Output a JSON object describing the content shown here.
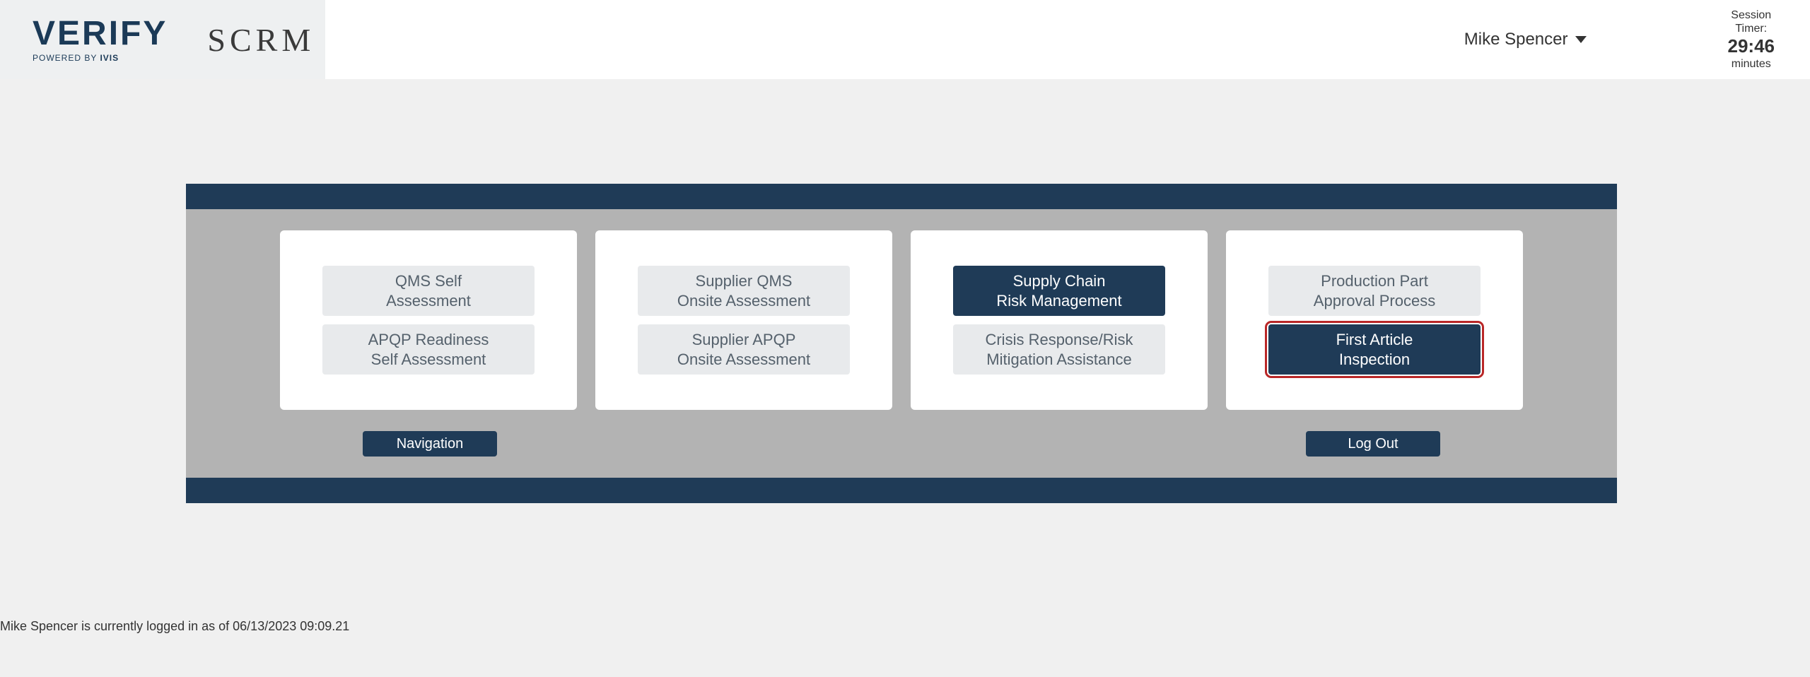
{
  "brand": {
    "logo_main": "VERIFY",
    "logo_sub_prefix": "POWERED BY ",
    "logo_sub_brand": "IVIS",
    "product": "SCRM"
  },
  "header": {
    "user_name": "Mike Spencer",
    "session_label1": "Session",
    "session_label2": "Timer:",
    "session_time": "29:46",
    "session_unit": "minutes"
  },
  "tiles": {
    "c1t1_l1": "QMS Self",
    "c1t1_l2": "Assessment",
    "c1t2_l1": "APQP Readiness",
    "c1t2_l2": "Self Assessment",
    "c2t1_l1": "Supplier QMS",
    "c2t1_l2": "Onsite Assessment",
    "c2t2_l1": "Supplier APQP",
    "c2t2_l2": "Onsite Assessment",
    "c3t1_l1": "Supply Chain",
    "c3t1_l2": "Risk Management",
    "c3t2_l1": "Crisis Response/Risk",
    "c3t2_l2": "Mitigation Assistance",
    "c4t1_l1": "Production Part",
    "c4t1_l2": "Approval Process",
    "c4t2_l1": "First Article",
    "c4t2_l2": "Inspection"
  },
  "buttons": {
    "navigation": "Navigation",
    "logout": "Log Out"
  },
  "status_line": "Mike Spencer is currently logged in as of 06/13/2023 09:09.21"
}
